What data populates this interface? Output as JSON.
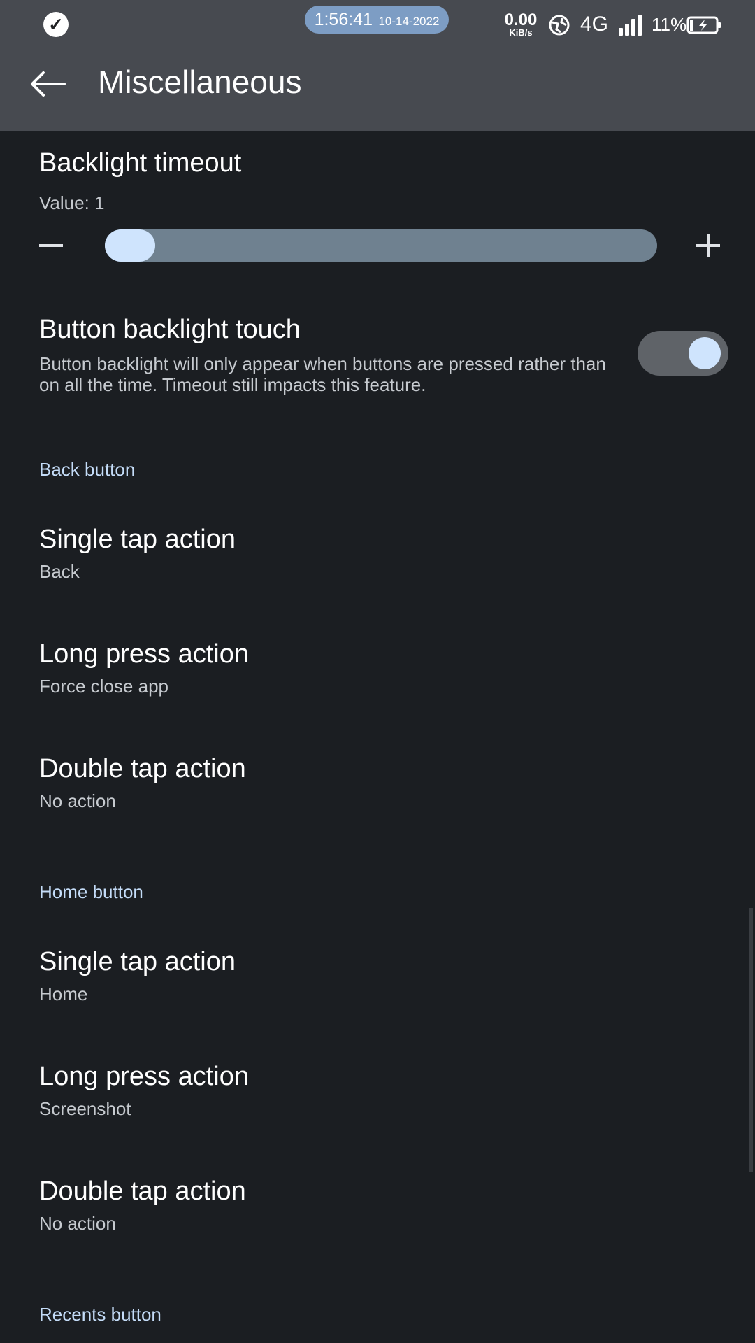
{
  "status_bar": {
    "time": "1:56:41",
    "date": "10-14-2022",
    "net_speed_value": "0.00",
    "net_speed_unit": "KiB/s",
    "network_type": "4G",
    "battery_percent": "11%"
  },
  "app_bar": {
    "title": "Miscellaneous"
  },
  "backlight_timeout": {
    "title": "Backlight timeout",
    "value_text": "Value: 1"
  },
  "button_backlight_touch": {
    "title": "Button backlight touch",
    "description": "Button backlight will only appear when buttons are pressed rather than on all the time. Timeout still impacts this feature.",
    "enabled": true
  },
  "back_button": {
    "header": "Back button",
    "items": [
      {
        "title": "Single tap action",
        "value": "Back"
      },
      {
        "title": "Long press action",
        "value": "Force close app"
      },
      {
        "title": "Double tap action",
        "value": "No action"
      }
    ]
  },
  "home_button": {
    "header": "Home button",
    "items": [
      {
        "title": "Single tap action",
        "value": "Home"
      },
      {
        "title": "Long press action",
        "value": "Screenshot"
      },
      {
        "title": "Double tap action",
        "value": "No action"
      }
    ]
  },
  "recents_button": {
    "header": "Recents button"
  },
  "colors": {
    "background": "#1b1e22",
    "app_bar": "#474a50",
    "accent": "#cfe4fd",
    "section_header": "#c4dcf8"
  }
}
